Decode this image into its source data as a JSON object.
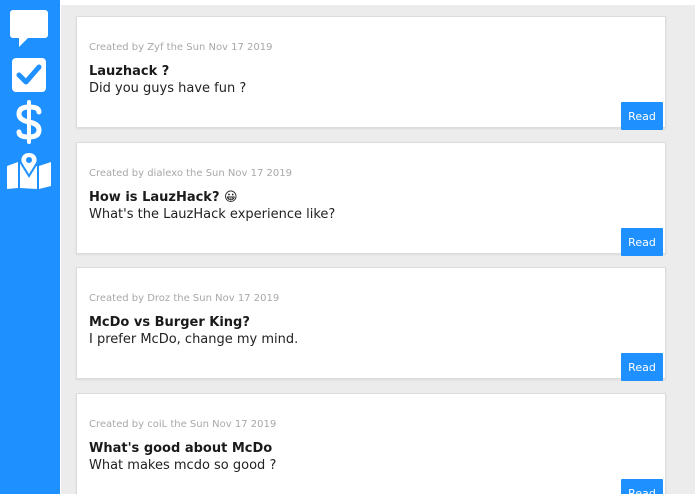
{
  "sidebar": {
    "items": [
      {
        "name": "chat-icon"
      },
      {
        "name": "checkbox-icon"
      },
      {
        "name": "dollar-icon"
      },
      {
        "name": "map-icon"
      }
    ],
    "accent": "#1e90ff"
  },
  "posts": [
    {
      "meta": "Created by Zyf the Sun Nov 17 2019",
      "title": "Lauzhack ?",
      "body": "Did you guys have fun ?",
      "button": "Read"
    },
    {
      "meta": "Created by dialexo the Sun Nov 17 2019",
      "title": "How is LauzHack? 😀",
      "body": "What's the LauzHack experience like?",
      "button": "Read"
    },
    {
      "meta": "Created by Droz the Sun Nov 17 2019",
      "title": "McDo vs Burger King?",
      "body": "I prefer McDo, change my mind.",
      "button": "Read"
    },
    {
      "meta": "Created by coiL the Sun Nov 17 2019",
      "title": "What's good about McDo",
      "body": "What makes mcdo so good ?",
      "button": "Read"
    }
  ]
}
